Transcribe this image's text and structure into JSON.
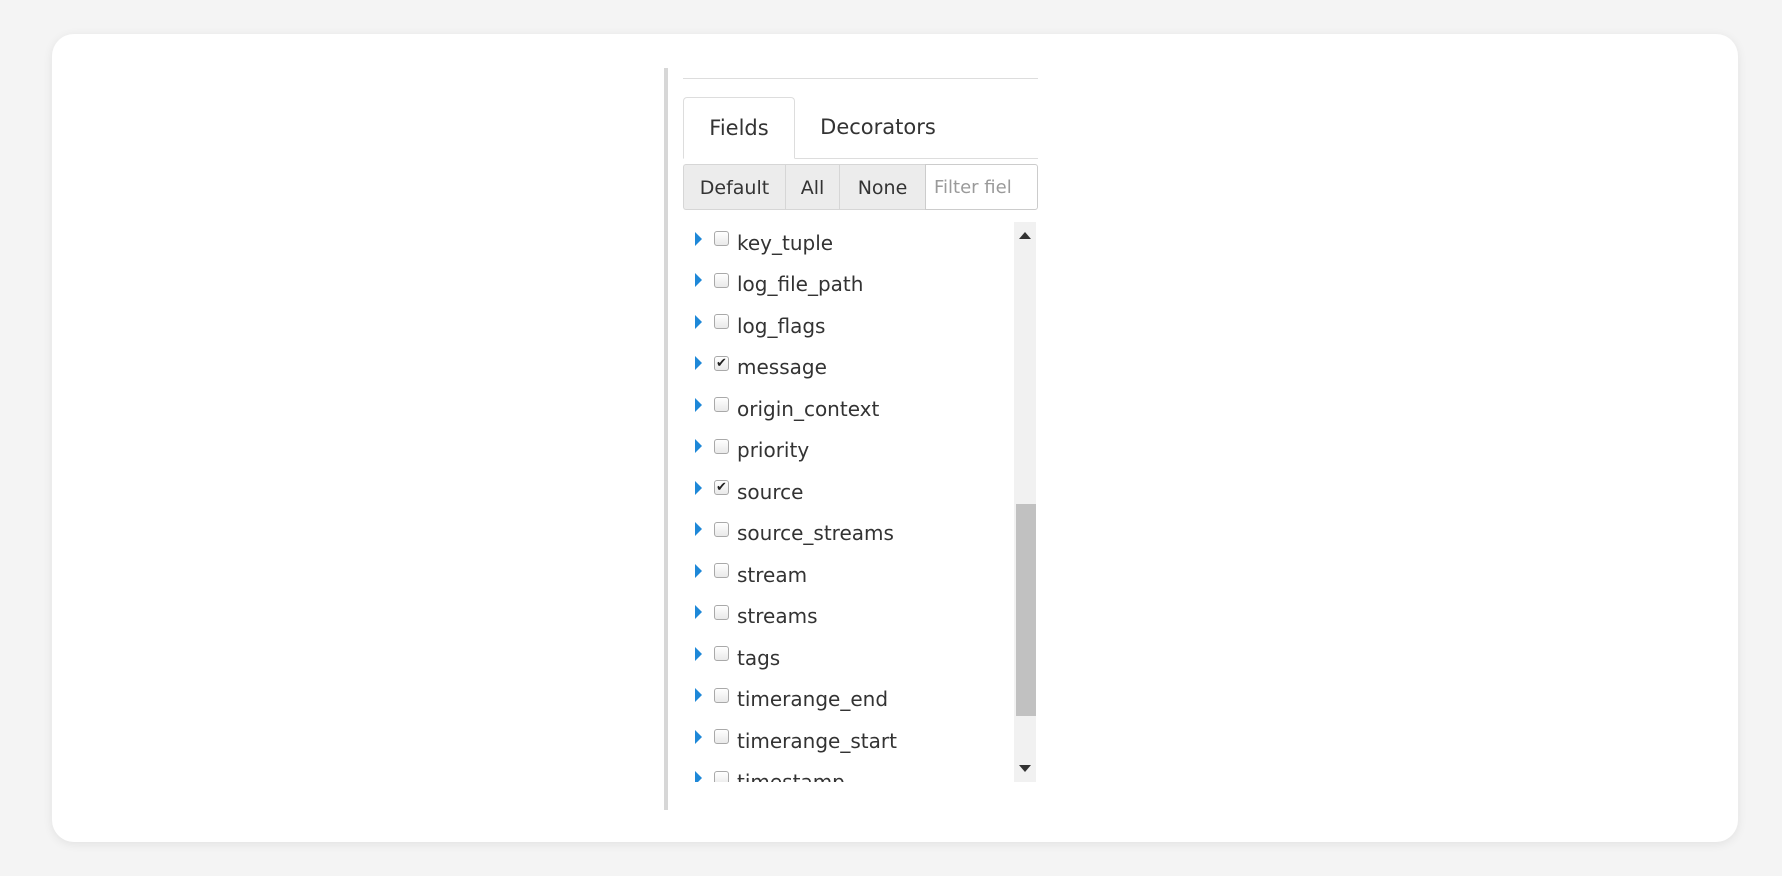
{
  "tabs": {
    "fields_label": "Fields",
    "decorators_label": "Decorators"
  },
  "toolbar": {
    "default_label": "Default",
    "all_label": "All",
    "none_label": "None",
    "filter_placeholder": "Filter fiel"
  },
  "fields": [
    {
      "name": "key_tuple",
      "checked": false
    },
    {
      "name": "log_file_path",
      "checked": false
    },
    {
      "name": "log_flags",
      "checked": false
    },
    {
      "name": "message",
      "checked": true
    },
    {
      "name": "origin_context",
      "checked": false
    },
    {
      "name": "priority",
      "checked": false
    },
    {
      "name": "source",
      "checked": true
    },
    {
      "name": "source_streams",
      "checked": false
    },
    {
      "name": "stream",
      "checked": false
    },
    {
      "name": "streams",
      "checked": false
    },
    {
      "name": "tags",
      "checked": false
    },
    {
      "name": "timerange_end",
      "checked": false
    },
    {
      "name": "timerange_start",
      "checked": false
    },
    {
      "name": "timestamp",
      "checked": false
    }
  ],
  "icons": {
    "expand": "caret-right-icon",
    "check": "checkmark-icon",
    "scroll_up": "arrow-up-icon",
    "scroll_down": "arrow-down-icon"
  },
  "colors": {
    "caret": "#1e88d8",
    "button_bg": "#ececec",
    "text": "#333333"
  }
}
